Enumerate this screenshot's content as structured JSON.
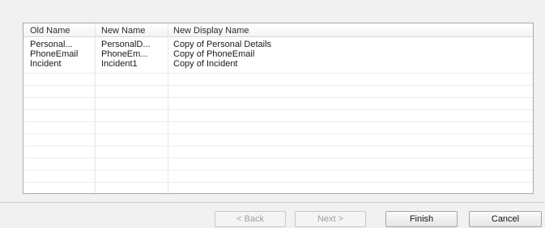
{
  "table": {
    "columns": [
      "Old Name",
      "New Name",
      "New Display Name"
    ],
    "rows": [
      [
        "Personal...",
        "PersonalD...",
        "Copy of Personal Details"
      ],
      [
        "PhoneEmail",
        "PhoneEm...",
        "Copy of PhoneEmail"
      ],
      [
        "Incident",
        "Incident1",
        "Copy of Incident"
      ]
    ]
  },
  "buttons": {
    "back": "< Back",
    "next": "Next >",
    "finish": "Finish",
    "cancel": "Cancel"
  }
}
